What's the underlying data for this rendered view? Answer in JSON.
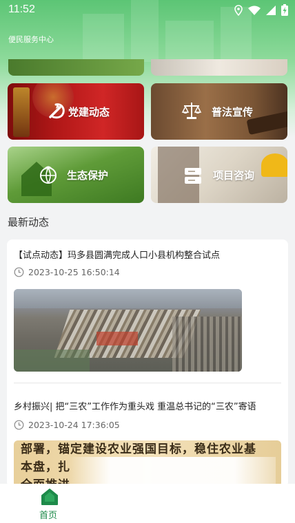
{
  "status_bar": {
    "time": "11:52"
  },
  "header": {
    "app_title": "便民服务中心"
  },
  "tiles": [
    {
      "label": "党建动态",
      "icon": "party-emblem-icon"
    },
    {
      "label": "普法宣传",
      "icon": "scales-of-justice-icon"
    },
    {
      "label": "生态保护",
      "icon": "globe-leaf-icon"
    },
    {
      "label": "项目咨询",
      "icon": "server-stack-icon"
    }
  ],
  "latest": {
    "section_title": "最新动态",
    "items": [
      {
        "title": "【试点动态】玛多县圆满完成人口小县机构整合试点",
        "timestamp": "2023-10-25 16:50:14"
      },
      {
        "title": "乡村振兴| 把“三农”工作作为重头戏 重温总书记的“三农”寄语",
        "timestamp": "2023-10-24 17:36:05",
        "image_text_lines": [
          "部署，锚定建设农业强国目标，稳住农业基",
          "本盘，扎",
          "全面推进"
        ]
      }
    ]
  },
  "tabbar": {
    "home_label": "首页",
    "home_icon": "home-icon"
  },
  "colors": {
    "brand_green": "#1e8a4a",
    "header_green": "#5cc575"
  }
}
